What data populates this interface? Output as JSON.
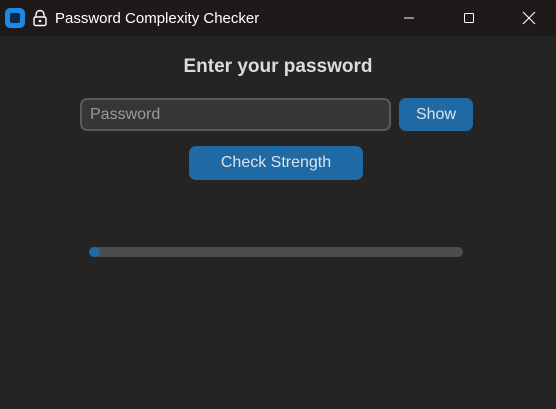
{
  "window": {
    "title": "Password Complexity Checker",
    "icons": {
      "app": "app-icon",
      "lock": "lock-icon",
      "minimize": "minimize-icon",
      "maximize": "maximize-icon",
      "close": "close-icon"
    }
  },
  "main": {
    "heading": "Enter your password",
    "password_input": {
      "value": "",
      "placeholder": "Password"
    },
    "show_button_label": "Show",
    "check_button_label": "Check Strength",
    "strength_progress": 0.03
  },
  "colors": {
    "accent": "#1f6aa5",
    "background": "#242424",
    "titlebar": "#1f1a1a",
    "progress_track": "#4a4d50"
  }
}
